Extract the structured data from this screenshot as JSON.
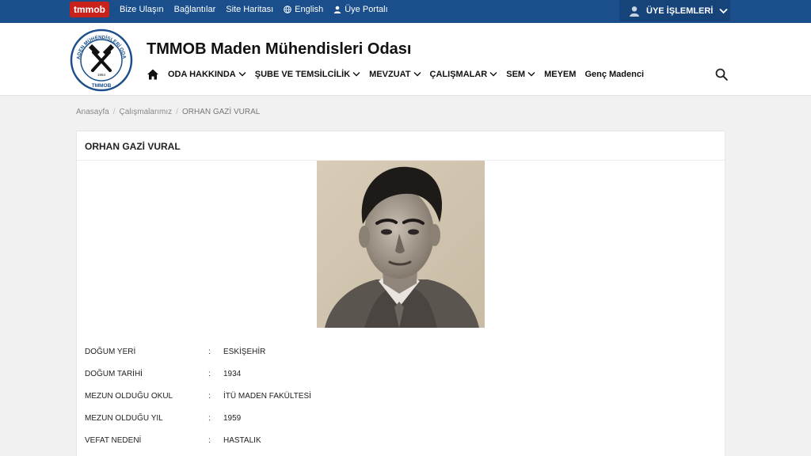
{
  "topbar": {
    "logo_text": "tmmob",
    "links": [
      "Bize Ulaşın",
      "Bağlantılar",
      "Site Haritası",
      "English",
      "Üye Portalı"
    ],
    "member_menu_label": "ÜYE İŞLEMLERİ",
    "bg_color": "#1b4f8c",
    "logo_color": "#c9221c"
  },
  "header": {
    "site_title": "TMMOB Maden Mühendisleri Odası",
    "seal_text_top": "MADEN MÜHENDİSLERİ ODASI",
    "seal_text_bottom": "TMMOB",
    "seal_year": "1954",
    "nav": {
      "items": [
        {
          "label": "ODA HAKKINDA"
        },
        {
          "label": "ŞUBE VE TEMSİLCİLİK"
        },
        {
          "label": "MEVZUAT"
        },
        {
          "label": "ÇALIŞMALAR"
        },
        {
          "label": "SEM"
        },
        {
          "label": "MEYEM"
        },
        {
          "label": "Genç Madenci"
        }
      ]
    },
    "icons": {
      "home": "home-icon",
      "search": "search-icon"
    }
  },
  "breadcrumb": {
    "items": [
      "Anasayfa",
      "Çalışmalarımız",
      "ORHAN GAZİ VURAL"
    ]
  },
  "profile": {
    "name": "ORHAN GAZİ VURAL",
    "rows": [
      {
        "label": "DOĞUM YERİ",
        "value": "ESKİŞEHİR"
      },
      {
        "label": "DOĞUM TARİHİ",
        "value": "1934"
      },
      {
        "label": "MEZUN OLDUĞU OKUL",
        "value": "İTÜ MADEN FAKÜLTESİ"
      },
      {
        "label": "MEZUN OLDUĞU YIL",
        "value": "1959"
      },
      {
        "label": "VEFAT NEDENİ",
        "value": "HASTALIK"
      }
    ],
    "separator": ":"
  }
}
